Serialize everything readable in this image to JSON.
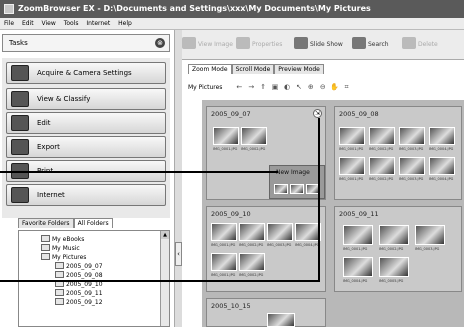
{
  "window": {
    "title": "ZoomBrowser EX - D:\\Documents and Settings\\xxx\\My Documents\\My Pictures"
  },
  "menu": [
    "File",
    "Edit",
    "View",
    "Tools",
    "Internet",
    "Help"
  ],
  "tasks": {
    "label": "Tasks"
  },
  "task_buttons": [
    "Acquire & Camera Settings",
    "View & Classify",
    "Edit",
    "Export",
    "Print",
    "Internet"
  ],
  "folder_tabs": [
    "Favorite Folders",
    "All Folders"
  ],
  "tree": [
    "My eBooks",
    "My Music",
    "My Pictures",
    "2005_09_07",
    "2005_09_08",
    "2005_09_10",
    "2005_09_11",
    "2005_09_12"
  ],
  "toolbar": {
    "view_image": "View Image",
    "properties": "Properties",
    "slide_show": "Slide Show",
    "search": "Search",
    "delete": "Delete"
  },
  "view_modes": [
    "Zoom Mode",
    "Scroll Mode",
    "Preview Mode"
  ],
  "breadcrumb": "My Pictures",
  "groups": {
    "g1": {
      "label": "2005_09_07",
      "new_image": "New Image"
    },
    "g2": {
      "label": "2005_09_08"
    },
    "g3": {
      "label": "2005_09_10"
    },
    "g4": {
      "label": "2005_09_11"
    },
    "g5": {
      "label": "2005_10_15"
    }
  },
  "captions": {
    "a": "IMG_0001.JPG",
    "b": "IMG_0002.JPG",
    "c": "IMG_0003.JPG",
    "d": "IMG_0004.JPG",
    "e": "IMG_0005.JPG"
  }
}
